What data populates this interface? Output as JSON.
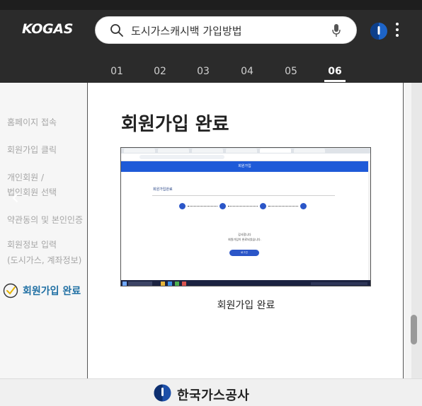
{
  "header": {
    "logo": "KOGAS",
    "search_text": "도시가스캐시백 가입방법",
    "steps": [
      "01",
      "02",
      "03",
      "04",
      "05",
      "06"
    ],
    "active_step": "06"
  },
  "menu": {
    "items": [
      "홈페이지 접속",
      "회원가입 클릭",
      "개인회원 /",
      "법인회원 선택",
      "약관동의 및 본인인증",
      "회원정보 입력",
      "(도시가스, 계좌정보)"
    ],
    "active": "회원가입 완료"
  },
  "content": {
    "title": "회원가입 완료",
    "caption": "회원가입 완료"
  },
  "screenshot": {
    "banner": "회원가입",
    "heading": "회원가입완료",
    "msg1": "감사합니다",
    "msg2": "회원가입이 완료되었습니다.",
    "button": "로그인"
  },
  "footer": {
    "org_name": "한국가스공사"
  },
  "colors": {
    "header_bg": "#2b2b2b",
    "accent_blue": "#1e5ad8",
    "active_menu": "#1f6fa3"
  }
}
